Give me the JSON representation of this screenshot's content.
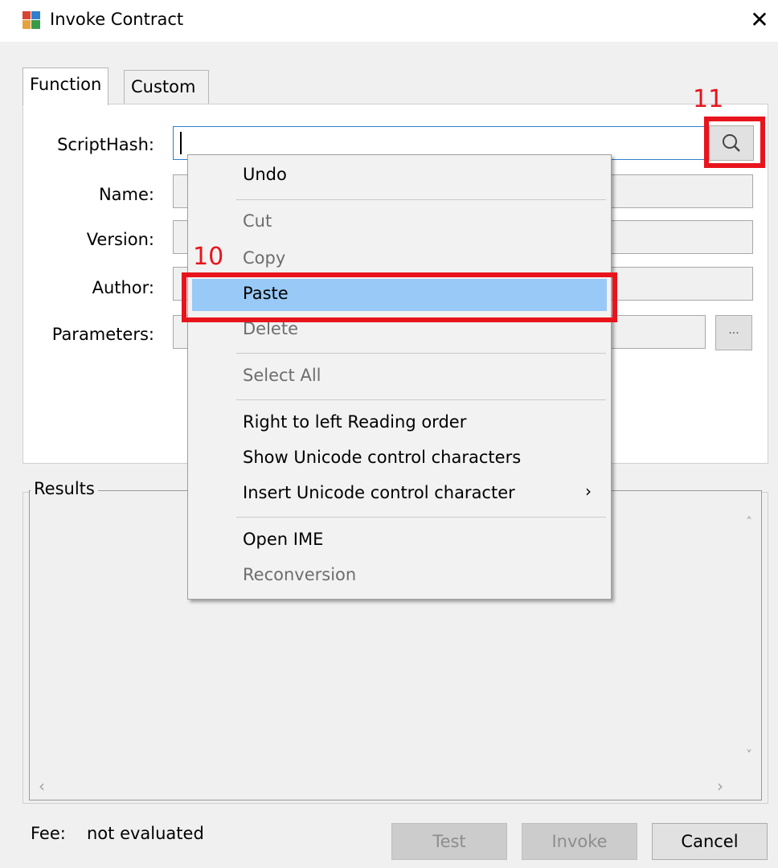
{
  "window": {
    "title": "Invoke Contract",
    "close_glyph": "✕"
  },
  "tabs": [
    {
      "label": "Function",
      "active": true
    },
    {
      "label": "Custom",
      "active": false
    }
  ],
  "form": {
    "scripthash_label": "ScriptHash:",
    "scripthash_value": "",
    "name_label": "Name:",
    "version_label": "Version:",
    "author_label": "Author:",
    "parameters_label": "Parameters:",
    "parameters_button": "..."
  },
  "results": {
    "label": "Results",
    "scroll_up": "˄",
    "scroll_down": "˅",
    "scroll_left": "‹",
    "scroll_right": "›"
  },
  "footer": {
    "fee_label": "Fee:",
    "fee_value": "not evaluated",
    "test_button": "Test",
    "invoke_button": "Invoke",
    "cancel_button": "Cancel"
  },
  "context_menu": {
    "items": [
      {
        "label": "Undo",
        "enabled": true
      },
      {
        "label": "Cut",
        "enabled": false
      },
      {
        "label": "Copy",
        "enabled": false
      },
      {
        "label": "Paste",
        "enabled": true,
        "highlighted": true
      },
      {
        "label": "Delete",
        "enabled": false
      },
      {
        "label": "Select All",
        "enabled": false
      },
      {
        "label": "Right to left Reading order",
        "enabled": true
      },
      {
        "label": "Show Unicode control characters",
        "enabled": true
      },
      {
        "label": "Insert Unicode control character",
        "enabled": true,
        "submenu": true
      },
      {
        "label": "Open IME",
        "enabled": true
      },
      {
        "label": "Reconversion",
        "enabled": false
      }
    ],
    "submenu_arrow": "›"
  },
  "annotations": {
    "callout_10": "10",
    "callout_11": "11",
    "color": "#e8141c"
  },
  "colors": {
    "highlight": "#99c9f6",
    "focus_border": "#2f7fd0"
  },
  "icons": {
    "app": "app-icon",
    "search": "search-icon",
    "close": "close-icon"
  }
}
